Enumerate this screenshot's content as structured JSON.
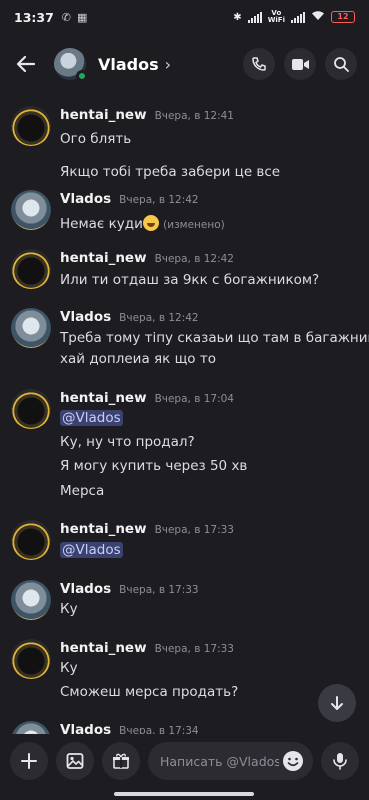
{
  "status_bar": {
    "time": "13:37",
    "network_label": "Vo\nWiFi",
    "battery": "12"
  },
  "header": {
    "name": "Vlados"
  },
  "messages": [
    {
      "author": "hentai_new",
      "avatar": "hentai",
      "time": "Вчера, в 12:41",
      "lines": [
        "Ого блять",
        "Якщо тобі треба забери це все"
      ]
    },
    {
      "author": "Vlados",
      "avatar": "vlados",
      "time": "Вчера, в 12:42",
      "lines": [
        "Немає куди"
      ],
      "edited": "(изменено)"
    },
    {
      "author": "hentai_new",
      "avatar": "hentai",
      "time": "Вчера, в 12:42",
      "lines": [
        "Или ти отдаш за 9кк с богажником?"
      ]
    },
    {
      "author": "Vlados",
      "avatar": "vlados",
      "time": "Вчера, в 12:42",
      "lines": [
        "Треба тому тіпу сказаьи що там в багажнику",
        "хай доплеиа як що то"
      ]
    },
    {
      "author": "hentai_new",
      "avatar": "hentai",
      "time": "Вчера, в 17:04",
      "mention": "@Vlados",
      "lines": [
        "Ку, ну что продал?",
        "Я могу купить через 50 хв",
        "Мерса"
      ]
    },
    {
      "author": "hentai_new",
      "avatar": "hentai",
      "time": "Вчера, в 17:33",
      "mention": "@Vlados",
      "lines": []
    },
    {
      "author": "Vlados",
      "avatar": "vlados",
      "time": "Вчера, в 17:33",
      "lines": [
        "Ку"
      ]
    },
    {
      "author": "hentai_new",
      "avatar": "hentai",
      "time": "Вчера, в 17:33",
      "lines": [
        "Ку",
        "Сможеш мерса продать?"
      ]
    },
    {
      "author": "Vlados",
      "avatar": "vlados",
      "time": "Вчера, в 17:34",
      "lines": []
    }
  ],
  "composer": {
    "placeholder": "Написать @Vlados"
  },
  "icons": {
    "back": "arrow-left-icon",
    "call": "phone-icon",
    "video": "video-camera-icon",
    "search": "search-icon",
    "add": "plus-icon",
    "image": "image-icon",
    "gift": "gift-icon",
    "emoji": "smile-icon",
    "mic": "microphone-icon",
    "scroll_down": "arrow-down-icon"
  },
  "colors": {
    "background": "#1c1c21",
    "online": "#23a55a",
    "mention_bg": "#3c4270",
    "battery_low": "#ff5a5a"
  }
}
